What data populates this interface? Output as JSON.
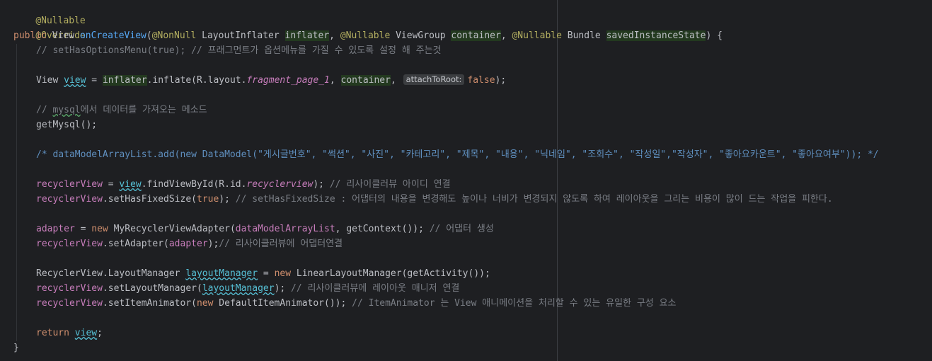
{
  "editor": {
    "lines": {
      "l1": {
        "a": "@Nullable"
      },
      "l2": {
        "a": "@Override"
      },
      "l3": {
        "kw": "public",
        "t1": " View ",
        "fn": "onCreateView",
        "t2": "(",
        "a1": "@NonNull",
        "t3": " LayoutInflater ",
        "p1": "inflater",
        "t4": ", ",
        "a2": "@Nullable",
        "t5": " ViewGroup ",
        "p2": "container",
        "t6": ", ",
        "a3": "@Nullable",
        "t7": " Bundle ",
        "p3": "savedInstanceState",
        "t8": ") {"
      },
      "l4": {
        "c": "// setHasOptionsMenu(true); // 프래그먼트가 옵션메뉴를 가질 수 있도록 설정 해 주는것"
      },
      "l5": {
        "t1": "View ",
        "v": "view",
        "t2": " = ",
        "p": "inflater",
        "t3": ".inflate(R.layout.",
        "f": "fragment_page_1",
        "t4": ", ",
        "p2": "container",
        "t5": ", ",
        "hint": "attachToRoot:",
        "kw": "false",
        "t6": ");"
      },
      "l6": {
        "c1": "// ",
        "c2": "mysql",
        "c3": "에서 데이터를 가져오는 메소드"
      },
      "l7": {
        "t": "getMysql();"
      },
      "l8": {
        "c": "/* dataModelArrayList.add(new DataModel(\"게시글번호\", \"썩션\", \"사진\", \"카테고리\", \"제목\", \"내용\", \"닉네임\", \"조회수\", \"작성일\",\"작성자\", \"좋아요카운트\", \"좋아요여부\")); */"
      },
      "l9": {
        "f": "recyclerView",
        "t1": " = ",
        "v": "view",
        "t2": ".findViewById(R.id.",
        "f2": "recyclerview",
        "t3": "); ",
        "c": "// 리사이클러뷰 아이디 연결"
      },
      "l10": {
        "f": "recyclerView",
        "t1": ".setHasFixedSize(",
        "kw": "true",
        "t2": "); ",
        "c": "// setHasFixedSize : 어댑터의 내용을 변경해도 높이나 너비가 변경되지 않도록 하여 레이아웃을 그리는 비용이 많이 드는 작업을 피한다."
      },
      "l11": {
        "f": "adapter",
        "t1": " = ",
        "kw": "new",
        "t2": " MyRecyclerViewAdapter(",
        "f2": "dataModelArrayList",
        "t3": ", getContext()); ",
        "c": "// 어댑터 생성"
      },
      "l12": {
        "f": "recyclerView",
        "t1": ".setAdapter(",
        "f2": "adapter",
        "t2": ");",
        "c": "// 리사이클러뷰에 어댑터연결"
      },
      "l13": {
        "t1": "RecyclerView.LayoutManager ",
        "v": "layoutManager",
        "t2": " = ",
        "kw": "new",
        "t3": " LinearLayoutManager(getActivity());"
      },
      "l14": {
        "f": "recyclerView",
        "t1": ".setLayoutManager(",
        "v": "layoutManager",
        "t2": "); ",
        "c": "// 리사이클러뷰에 레이아웃 매니저 연결"
      },
      "l15": {
        "f": "recyclerView",
        "t1": ".setItemAnimator(",
        "kw": "new",
        "t2": " DefaultItemAnimator()); ",
        "c": "// ItemAnimator 는 View 애니메이션을 처리할 수 있는 유일한 구성 요소"
      },
      "l16": {
        "kw": "return",
        "t1": " ",
        "v": "view",
        "t2": ";"
      },
      "l17": {
        "t": "}"
      }
    }
  },
  "colors": {
    "background": "#1e1f22",
    "keyword": "#cf8e6d",
    "annotation": "#b3ae60",
    "method": "#56a8f5",
    "field": "#c77dbb",
    "comment": "#7a7e85",
    "local_variable": "#56c1d6",
    "highlight": "#23391f"
  }
}
